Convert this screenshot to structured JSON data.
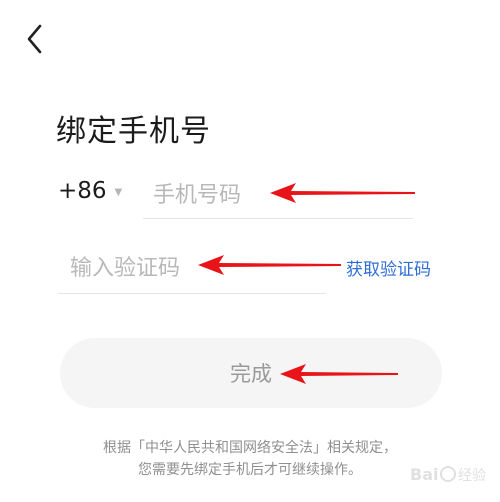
{
  "header": {
    "back_icon": "chevron-left-icon"
  },
  "page": {
    "title": "绑定手机号"
  },
  "phone": {
    "country_code": "+86",
    "country_caret_icon": "caret-down-icon",
    "placeholder": "手机号码"
  },
  "verification": {
    "placeholder": "输入验证码",
    "get_code_label": "获取验证码"
  },
  "submit": {
    "label": "完成"
  },
  "notice": {
    "line1": "根据「中华人民共和国网络安全法」相关规定，",
    "line2": "您需要先绑定手机后才可继续操作。"
  },
  "annotations": {
    "arrow_color": "#e8141a",
    "arrow_icon": "arrow-left-icon"
  },
  "watermark": {
    "text": "Baidu 经验"
  },
  "colors": {
    "link": "#2f6dd6",
    "button_bg": "#f5f5f5",
    "placeholder": "#b8b8b8"
  }
}
